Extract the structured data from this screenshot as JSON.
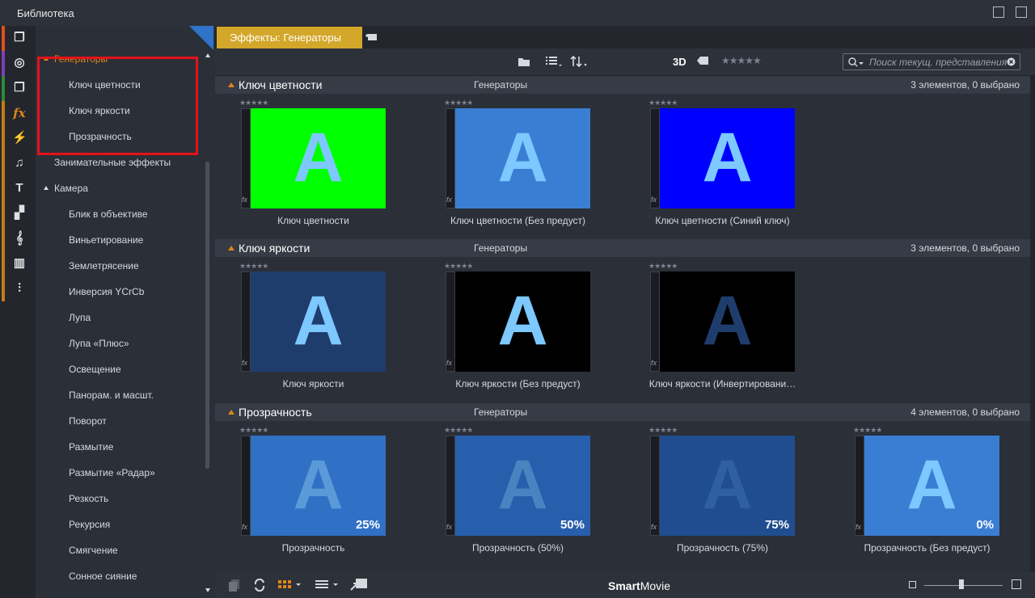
{
  "window": {
    "title": "Библиотека"
  },
  "sidebar_icons": [
    {
      "icon": "box-icon",
      "color": "#e0501c"
    },
    {
      "icon": "film-reel-icon",
      "color": "#7c3fb8"
    },
    {
      "icon": "pages-icon",
      "color": "#2f8a3b"
    },
    {
      "icon": "fx-icon",
      "color": "#c47b12"
    },
    {
      "icon": "lightning-icon",
      "color": "#c47b12"
    },
    {
      "icon": "music-note-icon",
      "color": "#c47b12"
    },
    {
      "icon": "text-icon",
      "color": "#c47b12"
    },
    {
      "icon": "montage-icon",
      "color": "#c47b12"
    },
    {
      "icon": "clef-icon",
      "color": "#c47b12"
    },
    {
      "icon": "piano-icon",
      "color": "#c47b12"
    },
    {
      "icon": "waveform-icon",
      "color": "#c47b12"
    }
  ],
  "tree": {
    "items": [
      {
        "label": "Генераторы",
        "active": true
      },
      {
        "label": "Ключ цветности"
      },
      {
        "label": "Ключ яркости"
      },
      {
        "label": "Прозрачность"
      },
      {
        "label": "Занимательные эффекты"
      },
      {
        "label": "Камера"
      },
      {
        "label": "Блик в объективе"
      },
      {
        "label": "Виньетирование"
      },
      {
        "label": "Землетрясение"
      },
      {
        "label": "Инверсия YCrCb"
      },
      {
        "label": "Лупа"
      },
      {
        "label": "Лупа «Плюс»"
      },
      {
        "label": "Освещение"
      },
      {
        "label": "Панорам. и масшт."
      },
      {
        "label": "Поворот"
      },
      {
        "label": "Размытие"
      },
      {
        "label": "Размытие «Радар»"
      },
      {
        "label": "Резкость"
      },
      {
        "label": "Рекурсия"
      },
      {
        "label": "Смягчение"
      },
      {
        "label": "Сонное сияние"
      }
    ]
  },
  "tab": {
    "label": "Эффекты: Генераторы"
  },
  "toolbar": {
    "mode_3d": "3D",
    "search_placeholder": "Поиск текущ. представления"
  },
  "sections": [
    {
      "name": "Ключ цветности",
      "category": "Генераторы",
      "count": "3 элементов, 0 выбрано",
      "items": [
        {
          "label": "Ключ цветности",
          "bg": "#00ff00",
          "fg": "#7cc8ff",
          "pct": ""
        },
        {
          "label": "Ключ цветности (Без предуст)",
          "bg": "#3a7ed3",
          "fg": "#7cc8ff",
          "pct": ""
        },
        {
          "label": "Ключ цветности (Синий ключ)",
          "bg": "#0000ff",
          "fg": "#7cc8ff",
          "pct": ""
        }
      ]
    },
    {
      "name": "Ключ яркости",
      "category": "Генераторы",
      "count": "3 элементов, 0 выбрано",
      "items": [
        {
          "label": "Ключ яркости",
          "bg": "#1f3d6c",
          "fg": "#7cc8ff",
          "pct": ""
        },
        {
          "label": "Ключ яркости (Без предуст)",
          "bg": "#000000",
          "fg": "#7cc8ff",
          "pct": ""
        },
        {
          "label": "Ключ яркости (Инвертировани…",
          "bg": "#000000",
          "fg": "#1f3d6c",
          "pct": ""
        }
      ]
    },
    {
      "name": "Прозрачность",
      "category": "Генераторы",
      "count": "4 элементов, 0 выбрано",
      "items": [
        {
          "label": "Прозрачность",
          "bg": "#3070c5",
          "fg": "#5a9ad8",
          "pct": "25%"
        },
        {
          "label": "Прозрачность (50%)",
          "bg": "#275fad",
          "fg": "#4a84c0",
          "pct": "50%"
        },
        {
          "label": "Прозрачность (75%)",
          "bg": "#1f4d8f",
          "fg": "#2f5f9f",
          "pct": "75%"
        },
        {
          "label": "Прозрачность (Без предуст)",
          "bg": "#3a7ed3",
          "fg": "#7cc8ff",
          "pct": "0%"
        }
      ]
    }
  ],
  "bottom": {
    "brand_bold": "Smart",
    "brand_rest": "Movie"
  }
}
